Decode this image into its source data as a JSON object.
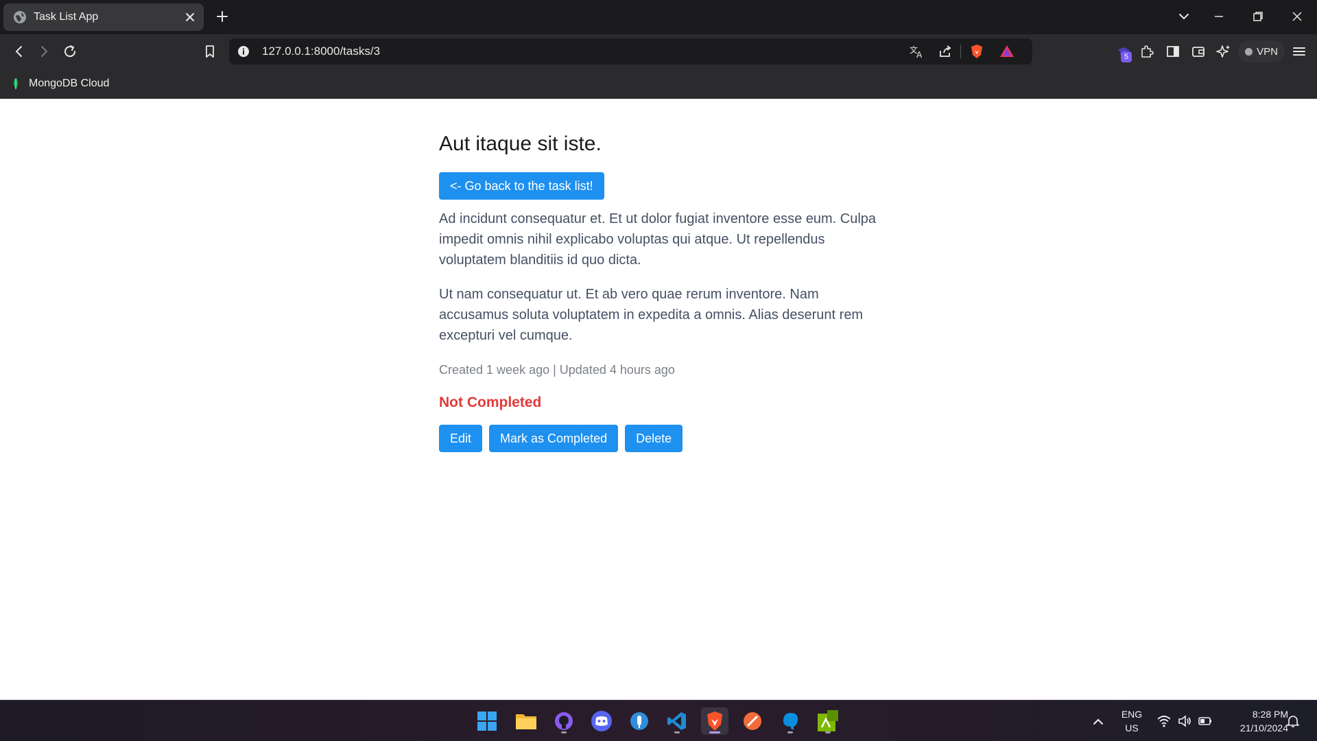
{
  "browser": {
    "tab_title": "Task List App",
    "url": "127.0.0.1:8000/tasks/3",
    "extension_badge": "5",
    "vpn_label": "VPN",
    "bookmark_label": "MongoDB Cloud"
  },
  "task": {
    "title": "Aut itaque sit iste.",
    "back_label": "<- Go back to the task list!",
    "description_1": "Ad incidunt consequatur et. Et ut dolor fugiat inventore esse eum. Culpa impedit omnis nihil explicabo voluptas qui atque. Ut repellendus voluptatem blanditiis id quo dicta.",
    "description_2": "Ut nam consequatur ut. Et ab vero quae rerum inventore. Nam accusamus soluta voluptatem in expedita a omnis. Alias deserunt rem excepturi vel cumque.",
    "meta": "Created 1 week ago | Updated 4 hours ago",
    "status": "Not Completed",
    "edit_label": "Edit",
    "complete_label": "Mark as Completed",
    "delete_label": "Delete"
  },
  "colors": {
    "button": "#1e90ef",
    "status_not_completed": "#e23a3a",
    "chrome_dark": "#1b1b1d",
    "chrome_mid": "#2b2b2d"
  },
  "taskbar": {
    "lang_1": "ENG",
    "lang_2": "US",
    "time": "8:28 PM",
    "date": "21/10/2024",
    "apps": [
      "windows-start",
      "file-explorer",
      "github-desktop",
      "discord",
      "postman-like",
      "vscode",
      "brave",
      "git-tool",
      "database-app",
      "terminal-app"
    ]
  }
}
